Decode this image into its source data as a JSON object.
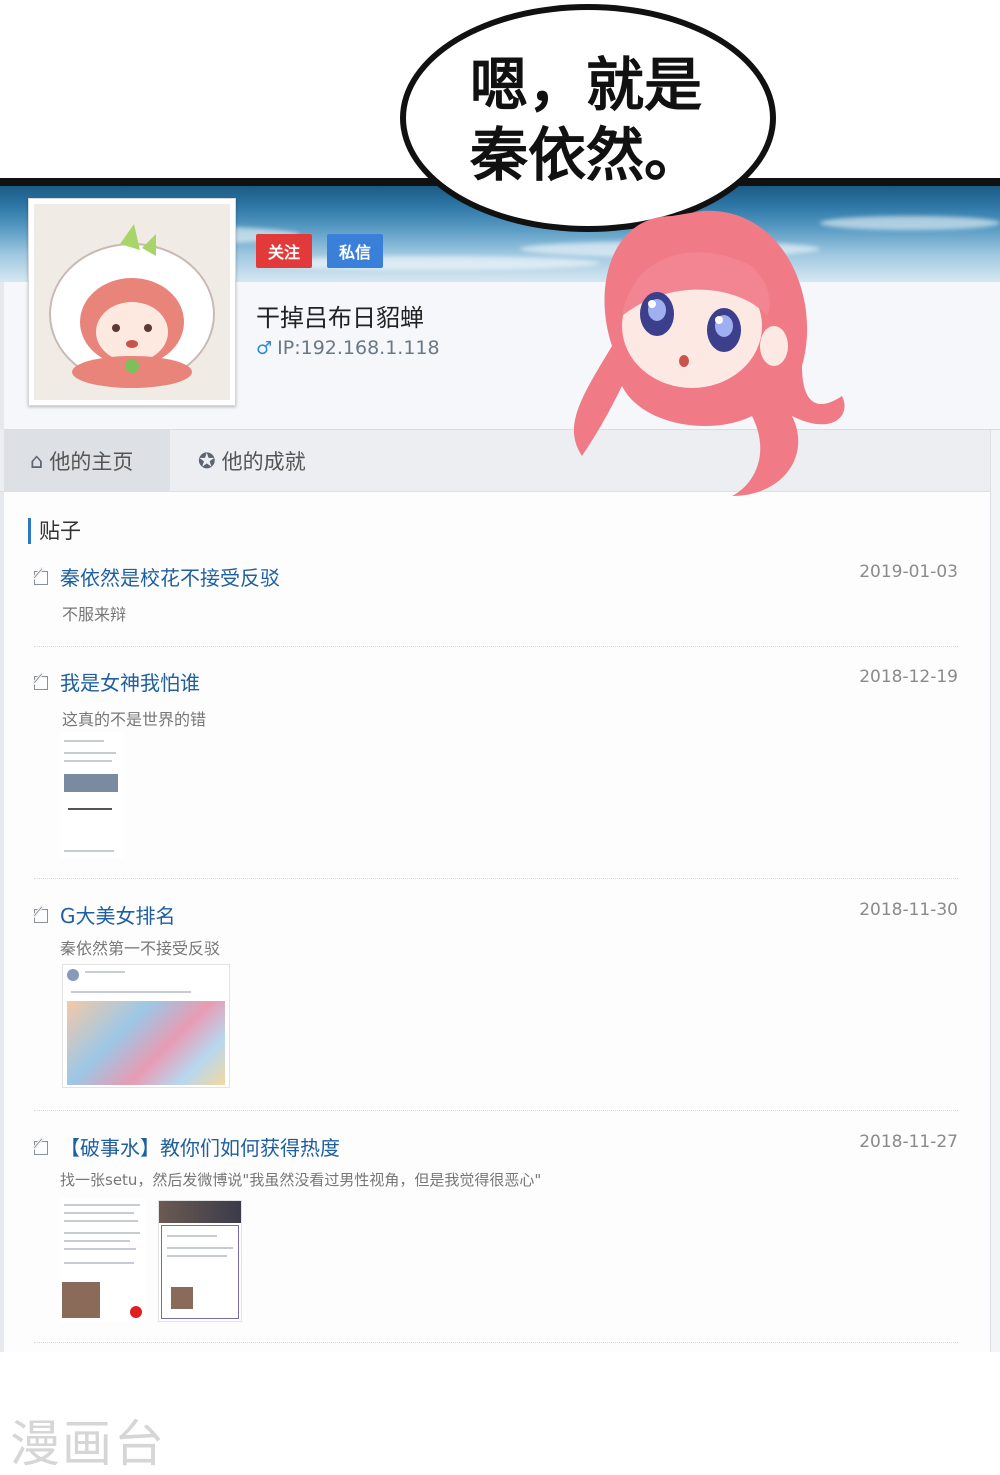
{
  "speech_bubble": {
    "line1": "嗯，就是",
    "line2": "秦依然。"
  },
  "profile": {
    "follow_label": "关注",
    "message_label": "私信",
    "username": "干掉吕布日貂蝉",
    "ip": "IP:192.168.1.118"
  },
  "tabs": [
    {
      "label": "他的主页",
      "icon": "home-icon",
      "active": true
    },
    {
      "label": "他的成就",
      "icon": "achievement-icon",
      "active": false
    }
  ],
  "section": {
    "title": "贴子"
  },
  "posts": [
    {
      "title": "秦依然是校花不接受反驳",
      "date": "2019-01-03",
      "desc": "不服来辩"
    },
    {
      "title": "我是女神我怕谁",
      "date": "2018-12-19",
      "desc": "这真的不是世界的错"
    },
    {
      "title": "G大美女排名",
      "date": "2018-11-30",
      "desc": "秦依然第一不接受反驳"
    },
    {
      "title": "【破事水】教你们如何获得热度",
      "date": "2018-11-27",
      "desc": "找一张setu，然后发微博说\"我虽然没看过男性视角，但是我觉得很恶心\""
    }
  ],
  "watermark": "漫画台",
  "colors": {
    "follow": "#e23a3a",
    "message": "#3a7fd8",
    "link": "#1f5f9f",
    "accent": "#2a79c9"
  }
}
